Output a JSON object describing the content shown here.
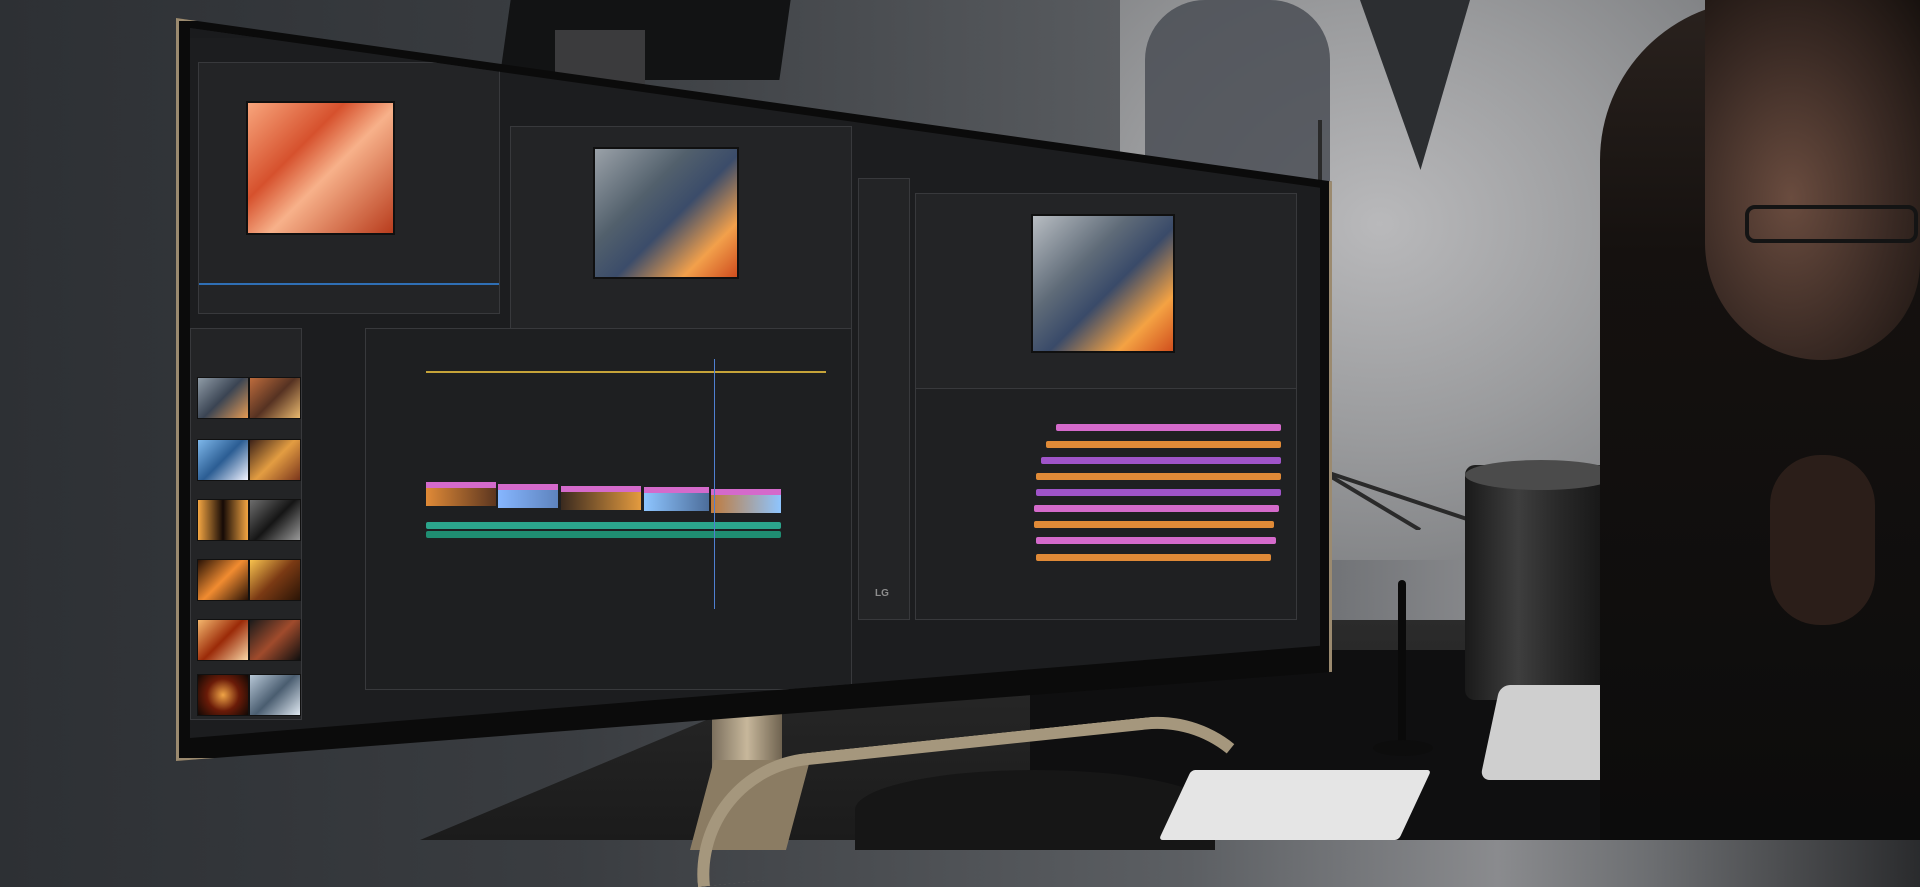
{
  "scene": {
    "monitor_brand_logo": "LG"
  },
  "colors": {
    "accent_pink": "#d46acb",
    "accent_teal": "#2ba58c",
    "accent_orange": "#e08a37",
    "accent_purple": "#9f54c9",
    "accent_lightblue": "#8ec5ff"
  }
}
